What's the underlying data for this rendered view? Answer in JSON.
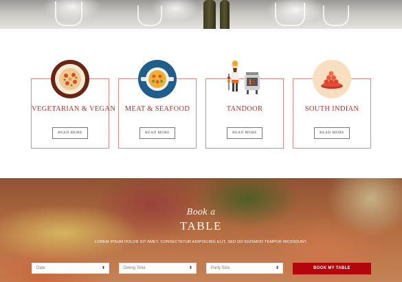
{
  "categories": [
    {
      "title": "VEGETARIAN & VEGAN",
      "button": "READ MORE",
      "icon": "vegetable-plate-icon"
    },
    {
      "title": "MEAT & SEAFOOD",
      "button": "READ MORE",
      "icon": "seafood-pan-icon"
    },
    {
      "title": "TANDOOR",
      "button": "READ MORE",
      "icon": "tandoor-chef-icon"
    },
    {
      "title": "SOUTH INDIAN",
      "button": "READ MORE",
      "icon": "sweets-plate-icon"
    }
  ],
  "booking": {
    "script_title": "Book a",
    "title": "TABLE",
    "description": "LOREM IPSUM DOLOR SIT AMET, CONSECTETUR ADIPISCING ELIT, SED DO EIUSMOD TEMPOR INCIDIDUNT.",
    "fields": {
      "date": "Date",
      "dining_time": "Dining Time",
      "party_size": "Party Size"
    },
    "button": "BOOK MY TABLE"
  },
  "colors": {
    "accent": "#a8332f",
    "card_border": "#d98a80",
    "book_button": "#b5050c"
  }
}
